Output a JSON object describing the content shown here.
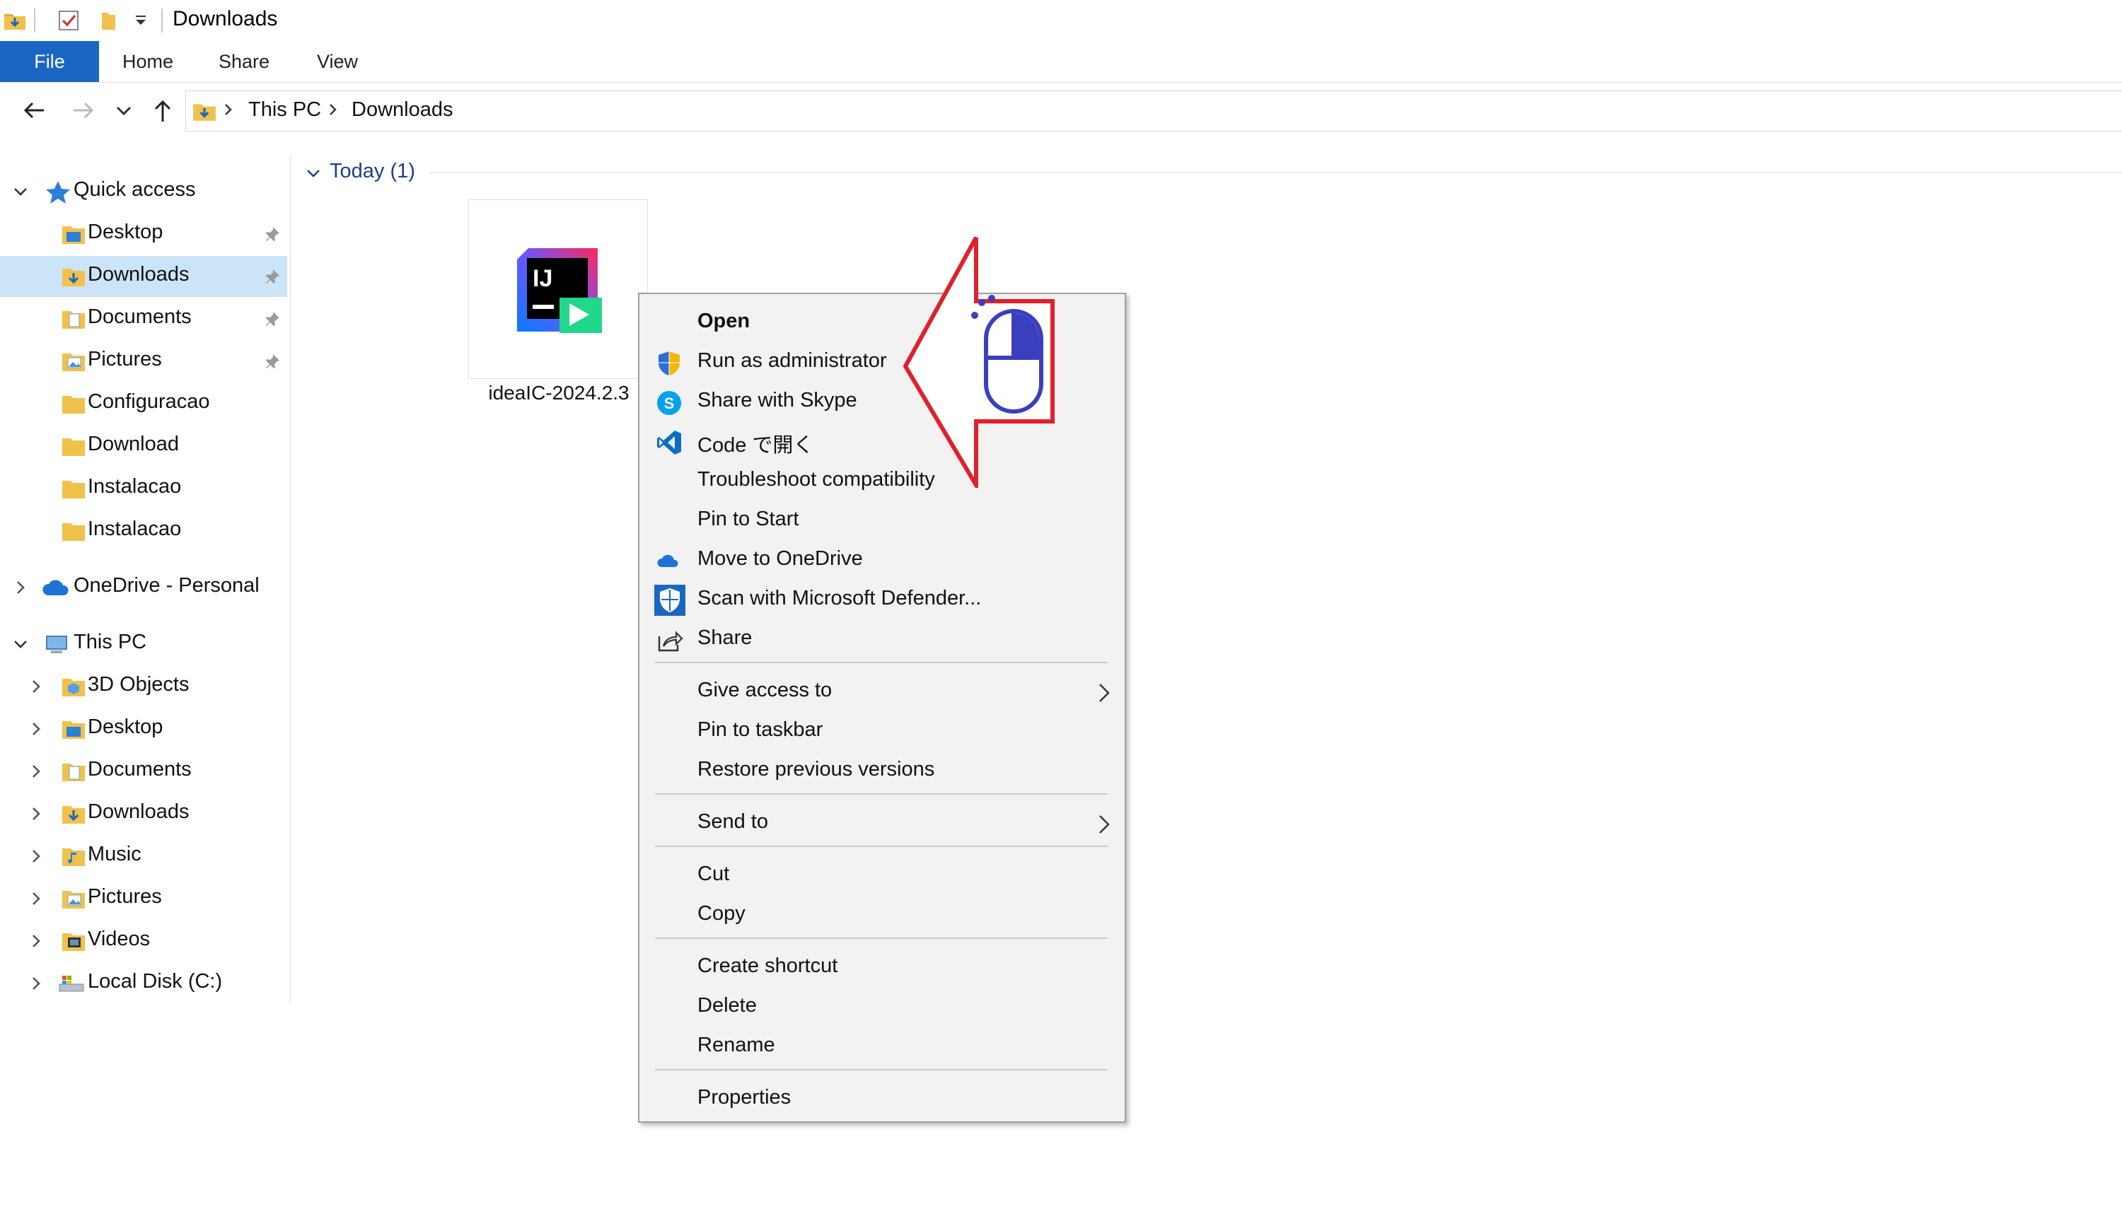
{
  "window": {
    "title": "Downloads"
  },
  "quick_access_toolbar": {
    "dropdown_icon": "chevron-down-icon"
  },
  "ribbon": {
    "tabs": [
      {
        "label": "File",
        "active": true
      },
      {
        "label": "Home"
      },
      {
        "label": "Share"
      },
      {
        "label": "View"
      }
    ],
    "accent": "#1a67c3"
  },
  "address": {
    "crumbs": [
      "This PC",
      "Downloads"
    ]
  },
  "nav_pane": {
    "quick_access": {
      "label": "Quick access",
      "items": [
        {
          "label": "Desktop",
          "pinned": true
        },
        {
          "label": "Downloads",
          "pinned": true,
          "selected": true
        },
        {
          "label": "Documents",
          "pinned": true
        },
        {
          "label": "Pictures",
          "pinned": true
        },
        {
          "label": "Configuracao"
        },
        {
          "label": "Download"
        },
        {
          "label": "Instalacao"
        },
        {
          "label": "Instalacao"
        }
      ]
    },
    "onedrive": {
      "label": "OneDrive - Personal"
    },
    "this_pc": {
      "label": "This PC",
      "items": [
        {
          "label": "3D Objects"
        },
        {
          "label": "Desktop"
        },
        {
          "label": "Documents"
        },
        {
          "label": "Downloads"
        },
        {
          "label": "Music"
        },
        {
          "label": "Pictures"
        },
        {
          "label": "Videos"
        },
        {
          "label": "Local Disk (C:)"
        }
      ]
    },
    "selection_color": "#cce4f7"
  },
  "content": {
    "group_header": "Today (1)",
    "file": {
      "name": "ideaIC-2024.2.3",
      "icon": "intellij-idea-icon"
    }
  },
  "context_menu": {
    "items": [
      {
        "label": "Open",
        "bold": true
      },
      {
        "label": "Run as administrator",
        "icon": "uac-shield-icon"
      },
      {
        "label": "Share with Skype",
        "icon": "skype-icon"
      },
      {
        "label": "Code で開く",
        "icon": "vscode-icon"
      },
      {
        "label": "Troubleshoot compatibility"
      },
      {
        "label": "Pin to Start"
      },
      {
        "label": "Move to OneDrive",
        "icon": "onedrive-icon"
      },
      {
        "label": "Scan with Microsoft Defender...",
        "icon": "defender-icon"
      },
      {
        "label": "Share",
        "icon": "share-icon"
      },
      {
        "label": "Give access to",
        "submenu": true
      },
      {
        "label": "Pin to taskbar"
      },
      {
        "label": "Restore previous versions"
      },
      {
        "label": "Send to",
        "submenu": true
      },
      {
        "label": "Cut"
      },
      {
        "label": "Copy"
      },
      {
        "label": "Create shortcut"
      },
      {
        "label": "Delete"
      },
      {
        "label": "Rename"
      },
      {
        "label": "Properties"
      }
    ]
  },
  "annotation": {
    "arrow_color": "#e0202a",
    "mouse_color": "#3a3fc0",
    "icon": "mouse-right-click-icon"
  }
}
